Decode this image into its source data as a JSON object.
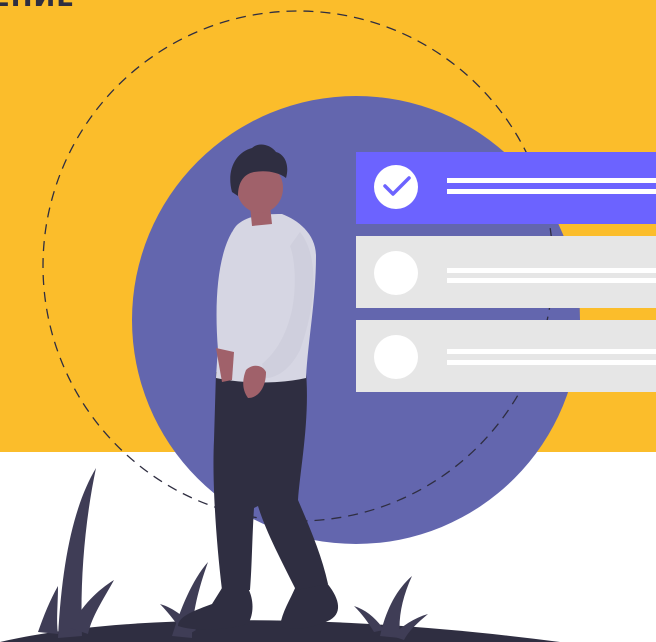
{
  "header": {
    "title_fragment": "ЕНИЕ"
  },
  "checklist": {
    "items": [
      {
        "state": "checked",
        "icon": "check-icon"
      },
      {
        "state": "unchecked",
        "icon": "empty-circle-icon"
      },
      {
        "state": "unchecked",
        "icon": "empty-circle-icon"
      }
    ]
  },
  "colors": {
    "background_top": "#fbbd2b",
    "background_bottom": "#ffffff",
    "accent_purple": "#6c63ff",
    "circle_slate": "#6366ae",
    "card_gray": "#e6e6e6",
    "text_dark": "#2f2e41",
    "skin": "#a0616a"
  }
}
